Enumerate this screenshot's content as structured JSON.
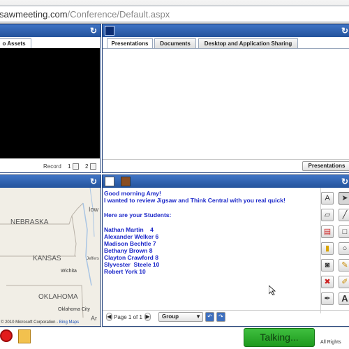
{
  "address_bar": {
    "url_host": "saw​meeting.com",
    "url_host_text": "sawmeeting.com",
    "url_path": "/Conference/Default.aspx"
  },
  "video_panel": {
    "tab_label": "o Assets",
    "record_label": "Record",
    "option_1": "1",
    "option_2": "2"
  },
  "content_panel": {
    "tabs": [
      "Presentations",
      "Documents",
      "Desktop and Application Sharing"
    ],
    "presentations_button": "Presentations"
  },
  "map_panel": {
    "labels": {
      "nebraska": "NEBRASKA",
      "kansas": "KANSAS",
      "oklahoma": "OKLAHOMA",
      "wichita": "Wichita",
      "oklahoma_city": "Oklahoma City",
      "iowa": "Iow",
      "jefferson": "Jeffers",
      "ar": "Ar"
    },
    "copyright": "© 2010 Microsoft Corporation -",
    "bing": "Bing Maps"
  },
  "whiteboard": {
    "greeting": "Good morning Amy!",
    "line2": "I wanted to review Jigsaw and Think Central with you real quick!",
    "heading": "Here are your Students:",
    "students": [
      "Nathan Martin    4",
      "Alexander Welker 6",
      "Madison Bechtle 7",
      "Bethany Brown 8",
      "Clayton Crawford 8",
      "Slyvester  Steele 10",
      "Robert York 10"
    ],
    "page_label": "Page 1 of 1",
    "group_select": "Group"
  },
  "bottom_bar": {
    "talk_button": "Talking...",
    "rights": "All Rights"
  },
  "colors": {
    "panel_header": "#2f5fae",
    "talk_green": "#2eb02e",
    "whiteboard_text": "#1b27c9"
  }
}
